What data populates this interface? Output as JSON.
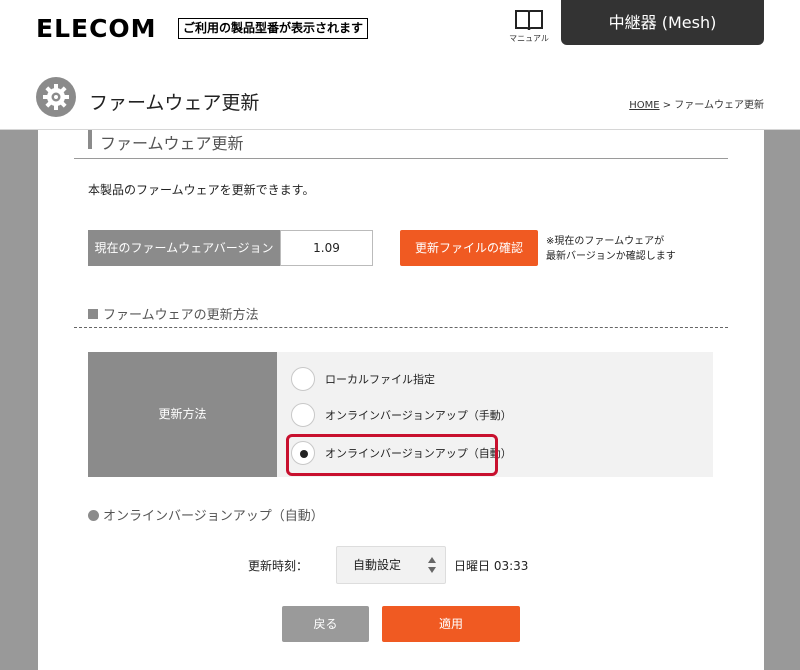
{
  "header": {
    "logo": "ELECOM",
    "model_placeholder": "ご利用の製品型番が表示されます",
    "manual_label": "マニュアル",
    "mode_tab": "中継器 (Mesh)"
  },
  "page": {
    "title": "ファームウェア更新",
    "breadcrumb_home": "HOME",
    "breadcrumb_current": "> ファームウェア更新"
  },
  "section": {
    "heading": "ファームウェア更新",
    "description": "本製品のファームウェアを更新できます。"
  },
  "version": {
    "label": "現在のファームウェアバージョン",
    "value": "1.09",
    "check_button": "更新ファイルの確認",
    "note_line1": "※現在のファームウェアが",
    "note_line2": "最新バージョンか確認します"
  },
  "method": {
    "heading": "ファームウェアの更新方法",
    "label": "更新方法",
    "options": [
      {
        "label": "ローカルファイル指定",
        "selected": false
      },
      {
        "label": "オンラインバージョンアップ（手動）",
        "selected": false
      },
      {
        "label": "オンラインバージョンアップ（自動）",
        "selected": true
      }
    ]
  },
  "auto_update": {
    "heading": "オンラインバージョンアップ（自動）",
    "time_label": "更新時刻：",
    "time_select": "自動設定",
    "time_value": "日曜日 03:33"
  },
  "buttons": {
    "back": "戻る",
    "apply": "適用"
  },
  "colors": {
    "accent": "#f05a22",
    "label_gray": "#8b8b8b",
    "header_dark": "#333333",
    "selection_red": "#c8102e"
  },
  "icons": {
    "manual": "book-icon",
    "settings": "gear-icon",
    "select": "updown-arrows-icon"
  }
}
